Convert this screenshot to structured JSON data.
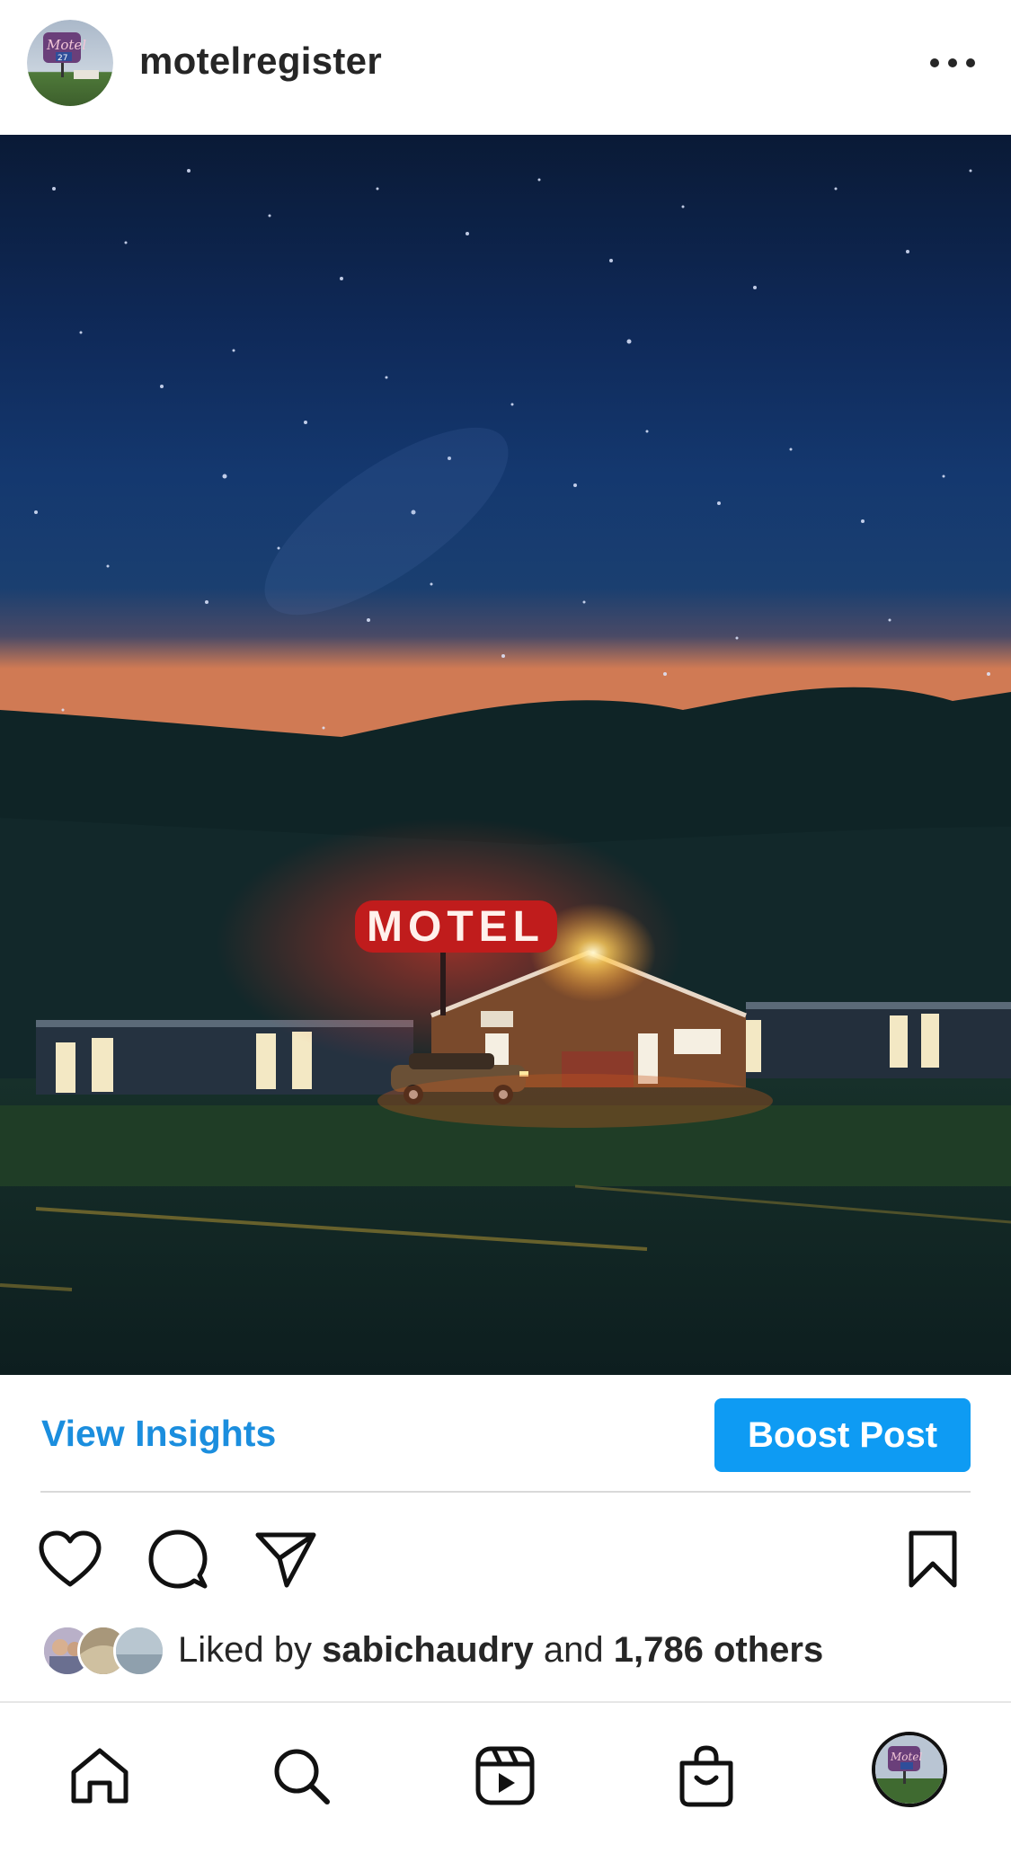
{
  "post": {
    "username": "motelregister",
    "sign_text": "MOTEL"
  },
  "insights": {
    "view_label": "View Insights",
    "boost_label": "Boost Post"
  },
  "likes": {
    "prefix": "Liked by ",
    "user": "sabichaudry",
    "middle": " and ",
    "others": "1,786 others"
  },
  "icons": {
    "more": "more-horizontal-icon",
    "like": "heart-icon",
    "comment": "comment-icon",
    "share": "send-icon",
    "save": "bookmark-icon",
    "home": "home-icon",
    "search": "search-icon",
    "reels": "reels-icon",
    "shop": "shop-bag-icon"
  },
  "colors": {
    "link_blue": "#1b8ede",
    "button_blue": "#0e9bf3"
  }
}
